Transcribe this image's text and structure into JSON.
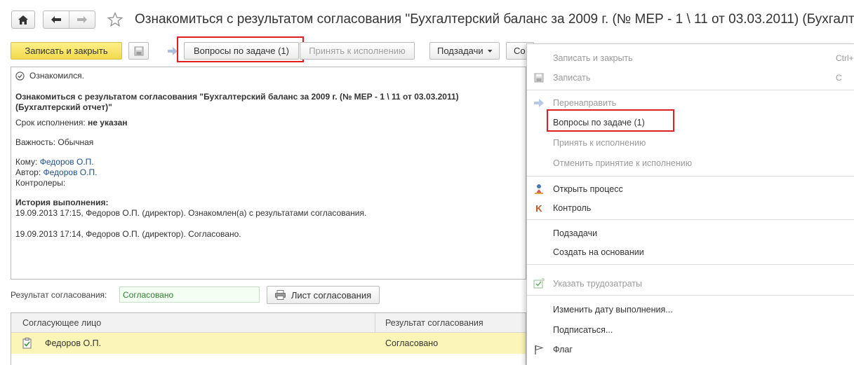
{
  "title": "Ознакомиться с результатом согласования \"Бухгалтерский баланс за 2009 г. (№ МЕР - 1 \\ 11 от 03.03.2011) (Бухгалт...",
  "toolbar": {
    "write_close": "Записать и закрыть",
    "questions": "Вопросы по задаче (1)",
    "accept": "Принять к исполнению",
    "subtasks": "Подзадачи",
    "create": "Со"
  },
  "doc": {
    "status": "Ознакомился.",
    "heading1": "Ознакомиться с результатом согласования \"Бухгалтерский баланс за 2009 г. (№ МЕР - 1 \\ 11 от 03.03.2011)",
    "heading2": "(Бухгалтерский отчет)\"",
    "deadline_label": "Срок исполнения:",
    "deadline_value": "не указан",
    "importance": "Важность: Обычная",
    "to_label": "Кому:",
    "to_value": "Федоров О.П.",
    "author_label": "Автор:",
    "author_value": "Федоров О.П.",
    "controllers": "Контролеры:",
    "history_title": "История выполнения:",
    "history": [
      "19.09.2013 17:15, Федоров О.П. (директор). Ознакомлен(а) с результатами согласования.",
      "19.09.2013 17:14, Федоров О.П. (директор). Согласовано."
    ]
  },
  "result": {
    "label": "Результат согласования:",
    "value": "Согласовано",
    "sheet_button": "Лист согласования"
  },
  "table": {
    "columns": [
      "Согласующее лицо",
      "Результат согласования"
    ],
    "rows": [
      {
        "person": "Федоров О.П.",
        "result": "Согласовано"
      }
    ]
  },
  "menu": {
    "items": [
      {
        "label": "Записать и закрыть",
        "shortcut": "Ctrl+",
        "disabled": true
      },
      {
        "label": "Записать",
        "shortcut": "C",
        "disabled": true,
        "icon": "save-icon"
      },
      {
        "label": "Перенаправить",
        "disabled": true,
        "icon": "redirect-arrow-icon"
      },
      {
        "label": "Вопросы по задаче (1)",
        "disabled": false
      },
      {
        "label": "Принять к исполнению",
        "disabled": true
      },
      {
        "label": "Отменить принятие к исполнению",
        "disabled": true
      },
      {
        "label": "Открыть процесс",
        "disabled": false,
        "icon": "process-icon"
      },
      {
        "label": "Контроль",
        "disabled": false,
        "icon": "control-k-icon"
      },
      {
        "label": "Подзадачи",
        "disabled": false
      },
      {
        "label": "Создать на основании",
        "disabled": false
      },
      {
        "label": "Указать трудозатраты",
        "disabled": true,
        "icon": "labor-icon"
      },
      {
        "label": "Изменить дату выполнения...",
        "disabled": false
      },
      {
        "label": "Подписаться...",
        "disabled": false
      },
      {
        "label": "Флаг",
        "disabled": false,
        "icon": "flag-icon"
      }
    ]
  },
  "icons": {
    "home": "home-icon",
    "back": "back-arrow-icon",
    "forward": "forward-arrow-icon",
    "star": "star-icon",
    "check": "check-circle-icon",
    "printer": "printer-icon"
  },
  "colors": {
    "primary_button": "#f1d94c",
    "link": "#1f4f8c",
    "highlight_row": "#fbf5b8",
    "annotation_red": "#e02020"
  }
}
